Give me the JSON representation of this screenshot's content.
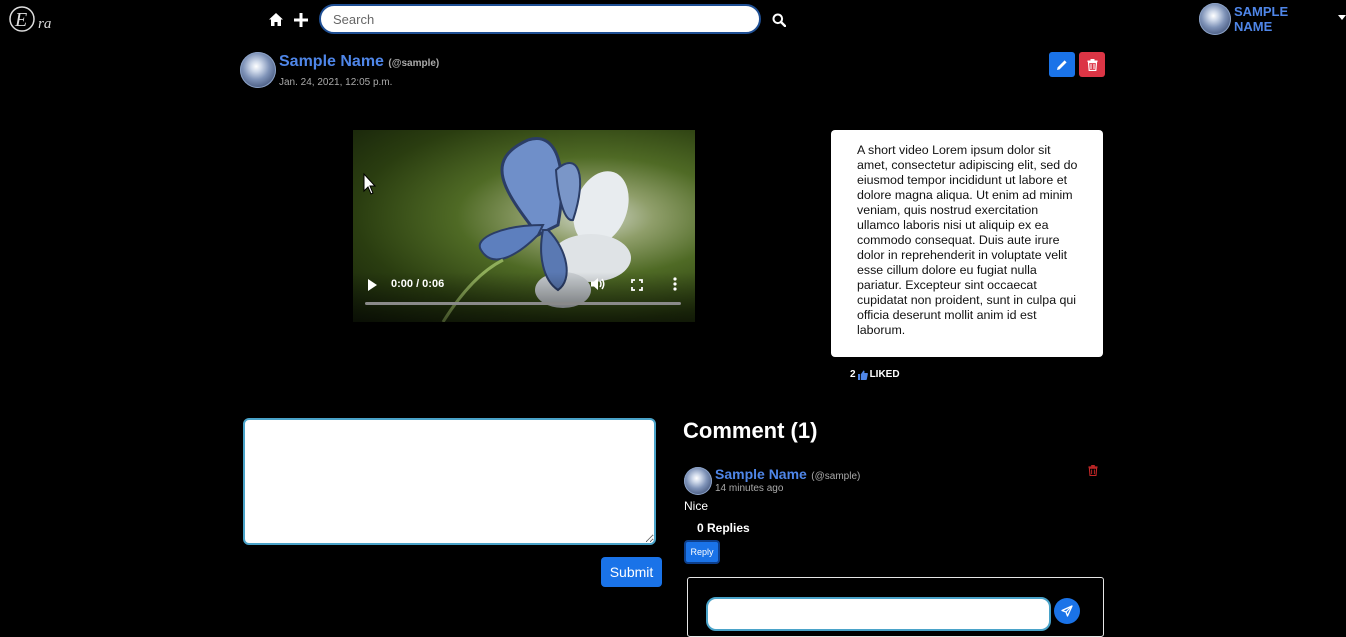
{
  "nav": {
    "logo_text": "Era",
    "search_placeholder": "Search",
    "user_name": "SAMPLE NAME",
    "icons": [
      "home-icon",
      "plus-icon",
      "search-icon",
      "chevron-down-icon"
    ]
  },
  "post": {
    "author_name": "Sample Name",
    "author_handle": "(@sample)",
    "date": "Jan. 24, 2021, 12:05 p.m.",
    "video": {
      "time": "0:00 / 0:06",
      "progress": 0
    },
    "description": "A short video Lorem ipsum dolor sit amet, consectetur adipiscing elit, sed do eiusmod tempor incididunt ut labore et dolore magna aliqua. Ut enim ad minim veniam, quis nostrud exercitation ullamco laboris nisi ut aliquip ex ea commodo consequat. Duis aute irure dolor in reprehenderit in voluptate velit esse cillum dolore eu fugiat nulla pariatur. Excepteur sint occaecat cupidatat non proident, sunt in culpa qui officia deserunt mollit anim id est laborum.",
    "like_count": "2",
    "like_label": "LIKED"
  },
  "comment_form": {
    "submit_label": "Submit"
  },
  "comments": {
    "heading": "Comment (1)",
    "items": [
      {
        "author_name": "Sample Name",
        "author_handle": "(@sample)",
        "time": "14 minutes ago",
        "text": "Nice",
        "replies_label": "0 Replies",
        "reply_label": "Reply"
      }
    ]
  },
  "colors": {
    "background": "#000000",
    "link_blue": "#4f86e8",
    "primary_button": "#1a73e8",
    "danger_button": "#dc3545",
    "input_border": "#4aa3c9"
  }
}
